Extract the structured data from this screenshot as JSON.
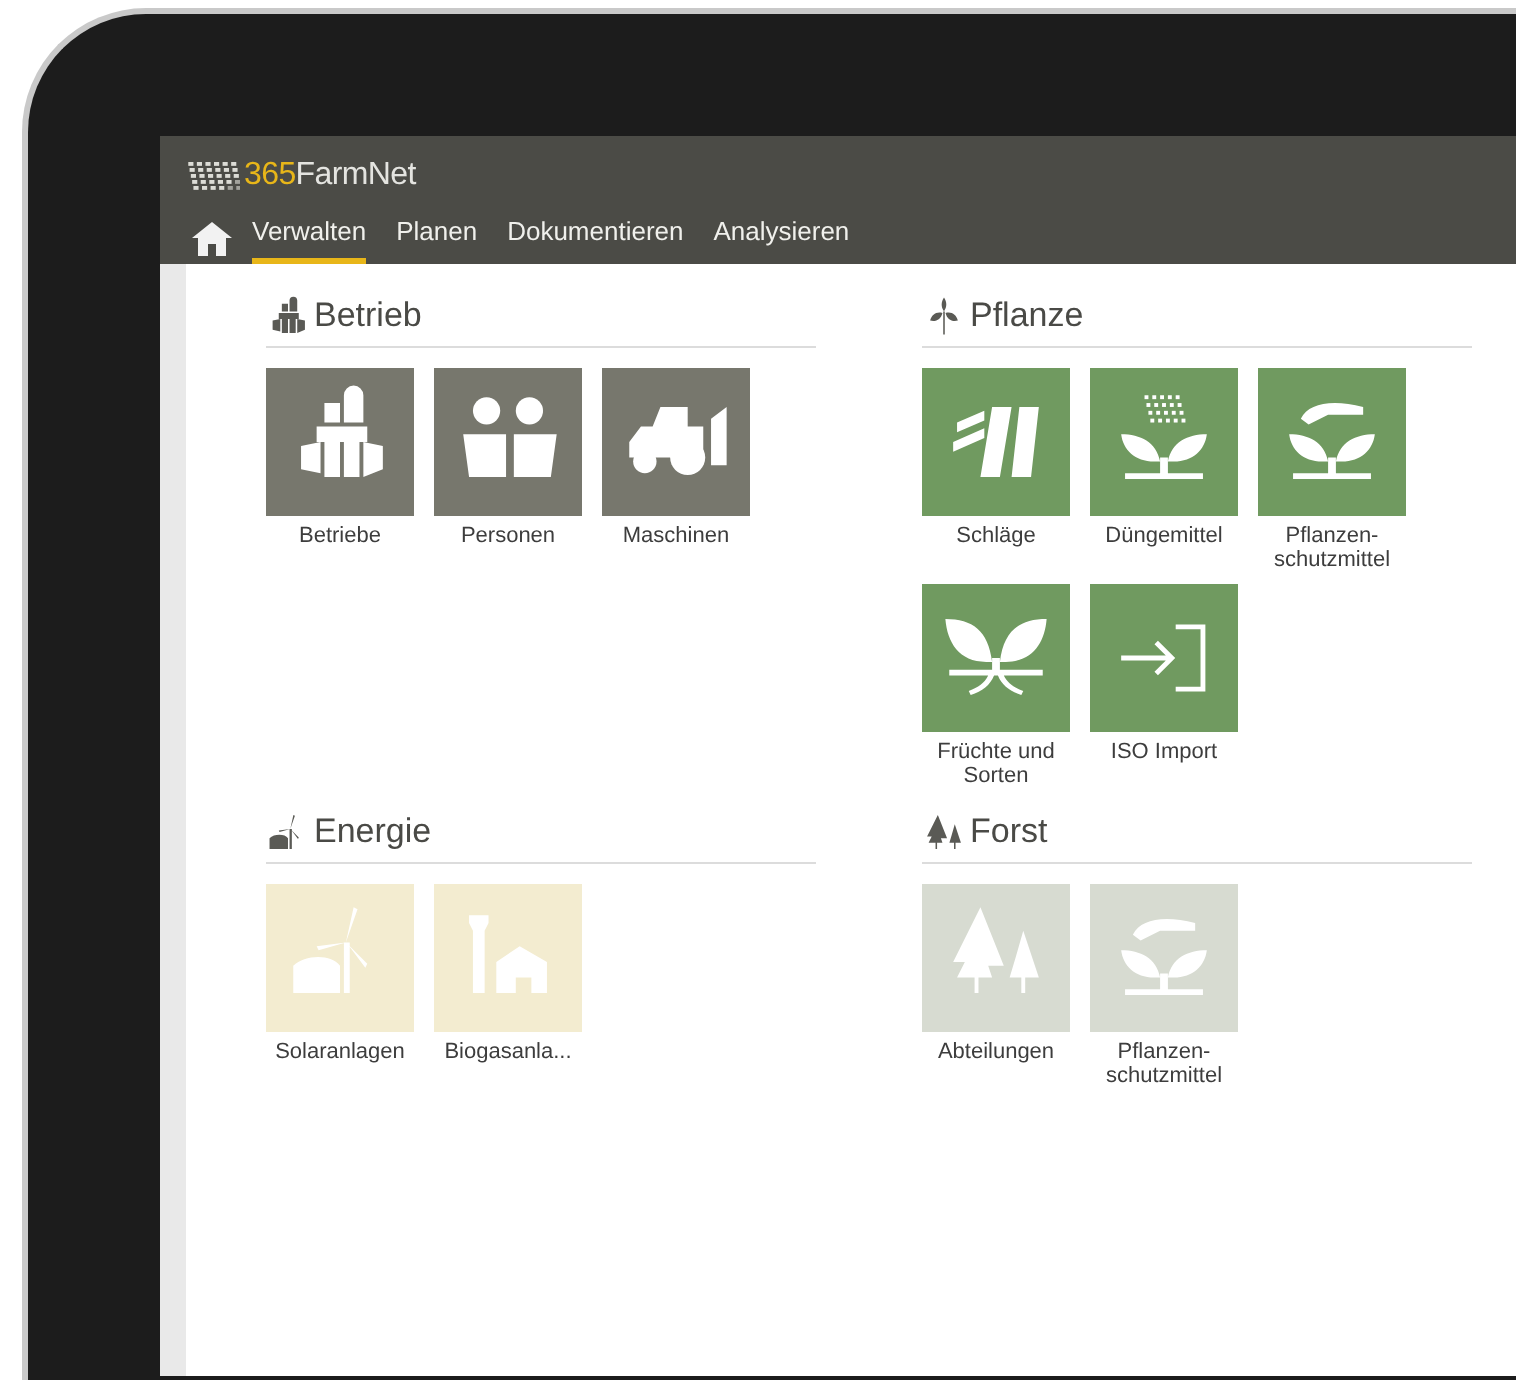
{
  "logo": {
    "prefix": "365",
    "name": "FarmNet"
  },
  "nav": [
    {
      "label": "Verwalten",
      "selected": true
    },
    {
      "label": "Planen",
      "selected": false
    },
    {
      "label": "Dokumentieren",
      "selected": false
    },
    {
      "label": "Analysieren",
      "selected": false
    }
  ],
  "sections": [
    {
      "title": "Betrieb",
      "color": "#77776d",
      "tiles": [
        {
          "label": "Betriebe"
        },
        {
          "label": "Personen"
        },
        {
          "label": "Maschinen"
        }
      ]
    },
    {
      "title": "Pflanze",
      "color": "#709a60",
      "tiles": [
        {
          "label": "Schläge"
        },
        {
          "label": "Düngemittel"
        },
        {
          "label": "Pflanzen-schutzmittel"
        },
        {
          "label": "Früchte und Sorten"
        },
        {
          "label": "ISO Import"
        }
      ]
    },
    {
      "title": "Energie",
      "color": "#f3ecd0",
      "tiles": [
        {
          "label": "Solaranlagen"
        },
        {
          "label": "Biogasanla..."
        }
      ]
    },
    {
      "title": "Forst",
      "color": "#d7dbd1",
      "tiles": [
        {
          "label": "Abteilungen"
        },
        {
          "label": "Pflanzen-schutzmittel"
        }
      ]
    }
  ]
}
